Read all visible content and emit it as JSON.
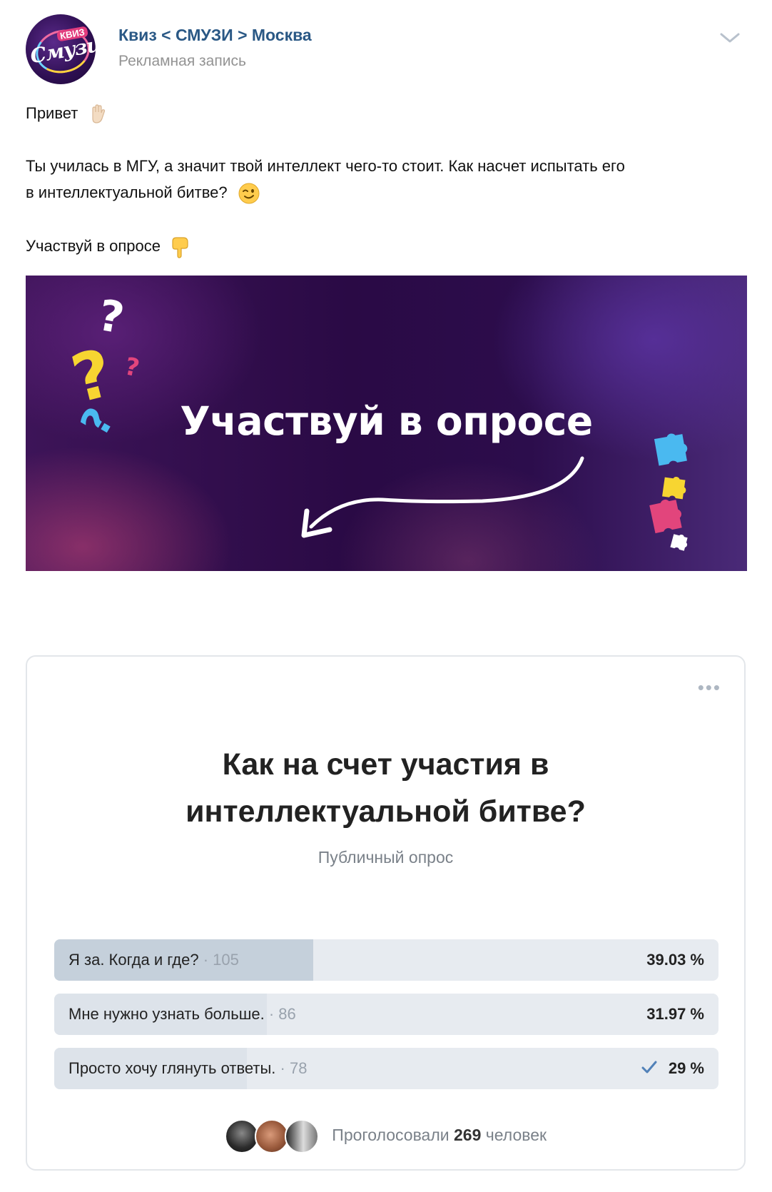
{
  "post": {
    "author": "Квиз < СМУЗИ > Москва",
    "ad_label": "Рекламная запись",
    "avatar": {
      "badge": "КВИЗ",
      "logo_text": "Смузи"
    },
    "greeting": "Привет",
    "body_line1": "Ты училась в МГУ, а значит твой интеллект чего-то стоит. Как насчет испытать его",
    "body_line2": "в интеллектуальной битве?",
    "cta": "Участвуй в опросе",
    "icons": [
      "waving-hand-icon",
      "winking-face-icon",
      "pointing-down-icon",
      "chevron-down-icon"
    ]
  },
  "banner": {
    "title": "Участвуй в опросе"
  },
  "poll": {
    "question_line1": "Как на счет участия в",
    "question_line2": "интеллектуальной битве?",
    "type": "Публичный опрос",
    "options": [
      {
        "label": "Я за. Когда и где?",
        "count": "· 105",
        "percent": "39.03 %",
        "fraction": 0.3903
      },
      {
        "label": "Мне нужно узнать больше.",
        "count": "· 86",
        "percent": "31.97 %",
        "fraction": 0.3197
      },
      {
        "label": "Просто хочу глянуть ответы.",
        "count": "· 78",
        "percent": "29 %",
        "fraction": 0.29,
        "selected": true
      }
    ],
    "voters_prefix": "Проголосовали",
    "voters_count": "269",
    "voters_suffix": "человек"
  },
  "colors": {
    "link": "#2a5885",
    "muted": "#939393",
    "poll_fill": "#c5d0db",
    "poll_track": "#e7ebf0",
    "check": "#5181b8"
  }
}
